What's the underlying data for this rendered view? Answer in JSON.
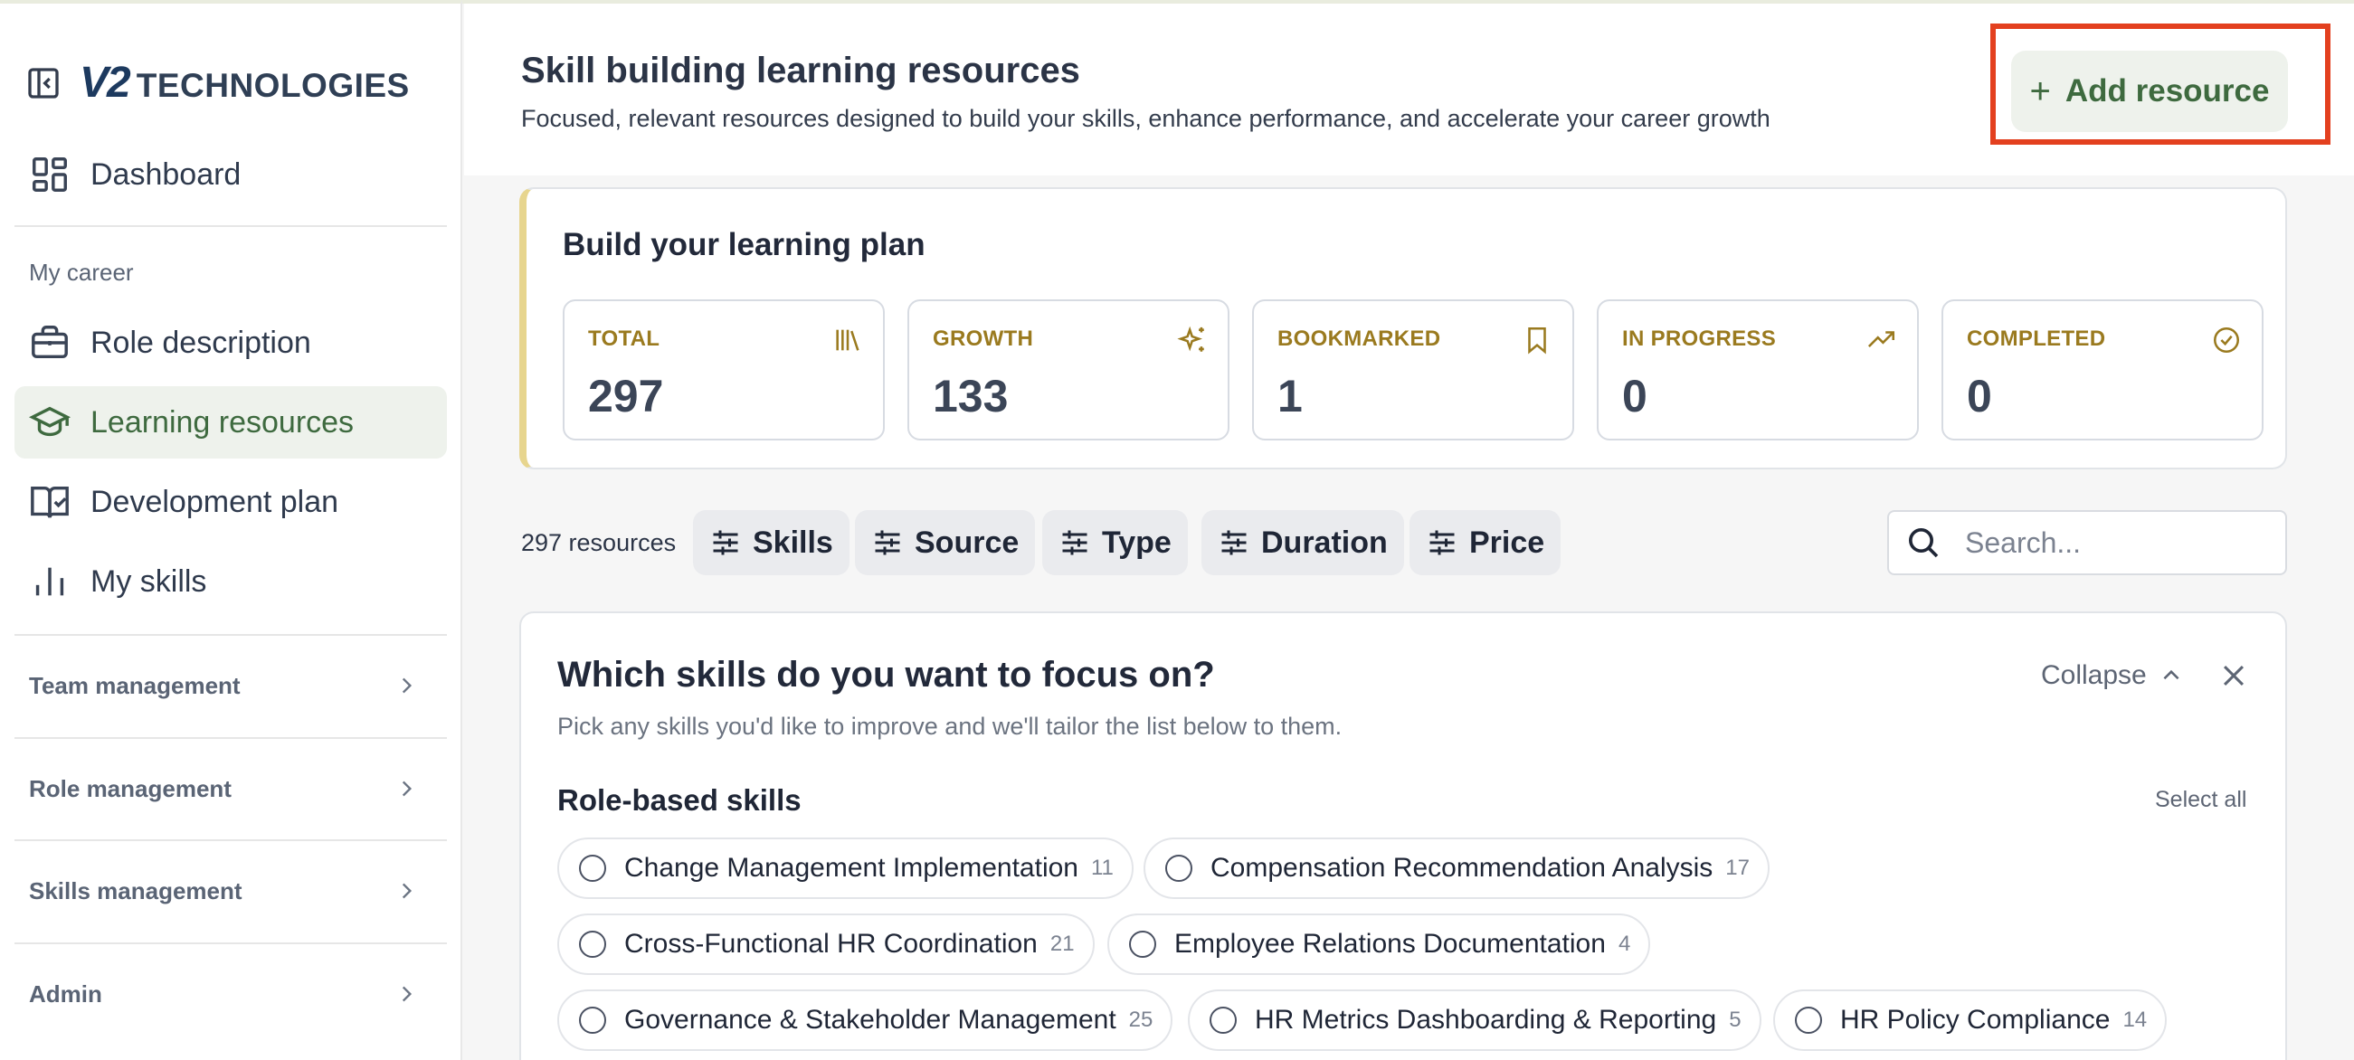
{
  "sidebar": {
    "brand": {
      "mark": "V2",
      "name": "TECHNOLOGIES"
    },
    "items": [
      {
        "label": "Dashboard"
      },
      {
        "label": "Role description"
      },
      {
        "label": "Learning resources"
      },
      {
        "label": "Development plan"
      },
      {
        "label": "My skills"
      }
    ],
    "section_label": "My career",
    "groups": [
      {
        "label": "Team management"
      },
      {
        "label": "Role management"
      },
      {
        "label": "Skills management"
      },
      {
        "label": "Admin"
      }
    ],
    "active_item": "Learning resources"
  },
  "header": {
    "title": "Skill building learning resources",
    "subtitle": "Focused, relevant resources designed to build your skills, enhance performance, and accelerate your career growth",
    "add_button": "Add resource",
    "add_button_icon": "+"
  },
  "plan": {
    "title": "Build your learning plan",
    "stats": [
      {
        "label": "TOTAL",
        "value": "297",
        "icon": "library-icon"
      },
      {
        "label": "GROWTH",
        "value": "133",
        "icon": "sparkles-icon"
      },
      {
        "label": "BOOKMARKED",
        "value": "1",
        "icon": "bookmark-icon"
      },
      {
        "label": "IN PROGRESS",
        "value": "0",
        "icon": "trending-up-icon"
      },
      {
        "label": "COMPLETED",
        "value": "0",
        "icon": "check-circle-icon"
      }
    ]
  },
  "filters": {
    "count": "297 resources",
    "chips": [
      "Skills",
      "Source",
      "Type",
      "Duration",
      "Price"
    ],
    "search_placeholder": "Search..."
  },
  "skills": {
    "title": "Which skills do you want to focus on?",
    "subtitle": "Pick any skills you'd like to improve and we'll tailor the list below to them.",
    "collapse": "Collapse",
    "section_title": "Role-based skills",
    "select_all": "Select all",
    "items": [
      {
        "label": "Change Management Implementation",
        "count": "11"
      },
      {
        "label": "Compensation Recommendation Analysis",
        "count": "17"
      },
      {
        "label": "Cross-Functional HR Coordination",
        "count": "21"
      },
      {
        "label": "Employee Relations Documentation",
        "count": "4"
      },
      {
        "label": "Governance & Stakeholder Management",
        "count": "25"
      },
      {
        "label": "HR Metrics Dashboarding & Reporting",
        "count": "5"
      },
      {
        "label": "HR Policy Compliance",
        "count": "14"
      }
    ]
  },
  "colors": {
    "accent_green": "#3e6a3f",
    "accent_green_bg": "#eef2ec",
    "stat_label_gold": "#9a7a1f",
    "highlight_red": "#e3401f"
  }
}
